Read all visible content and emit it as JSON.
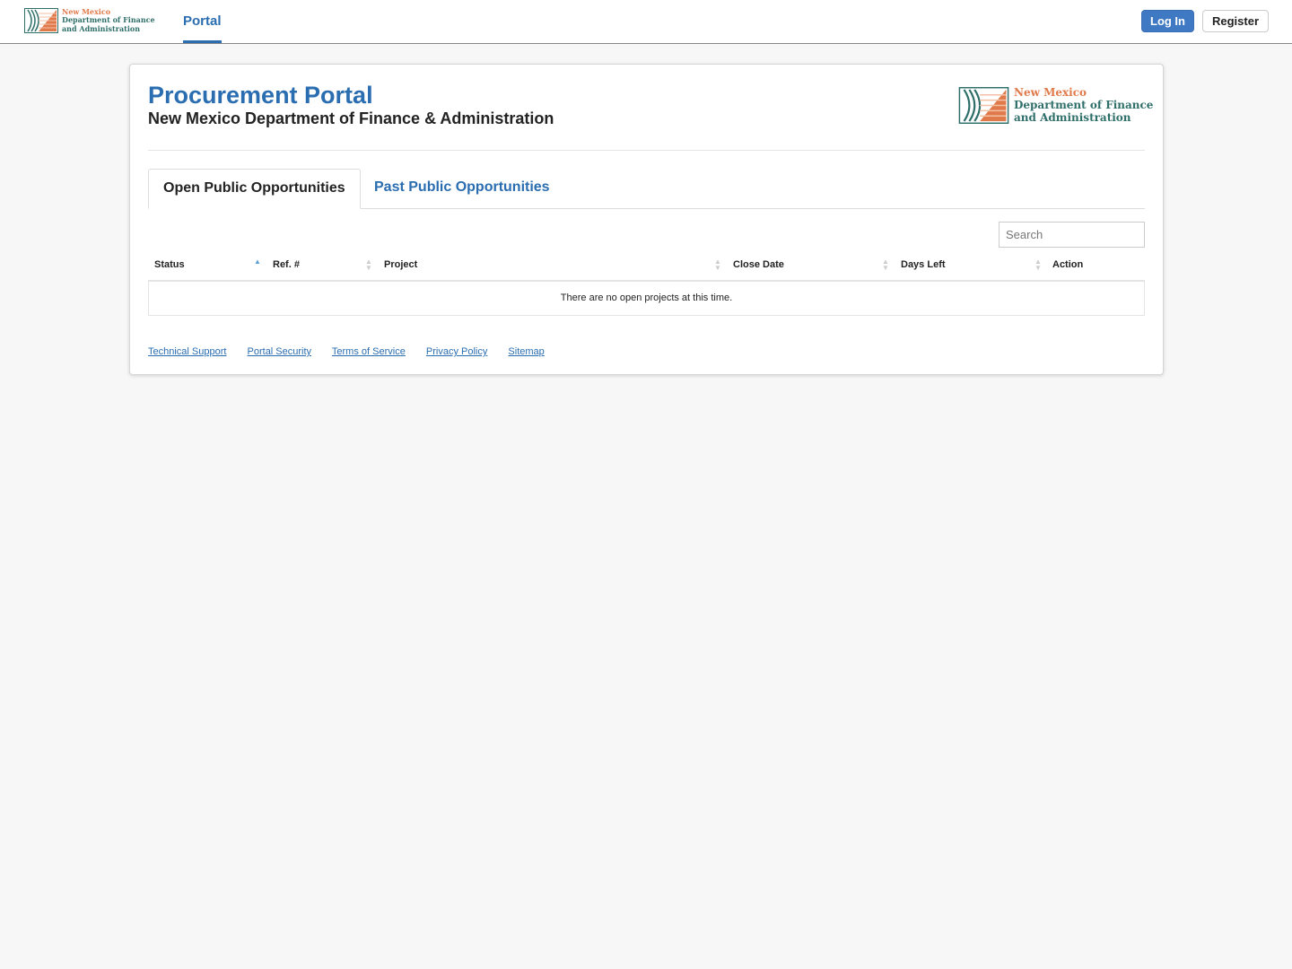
{
  "logo": {
    "line1": "New Mexico",
    "line2": "Department of Finance",
    "line3": "and Administration"
  },
  "nav": {
    "portal": "Portal",
    "login": "Log In",
    "register": "Register"
  },
  "header": {
    "title": "Procurement Portal",
    "subtitle": "New Mexico Department of Finance & Administration"
  },
  "tabs": [
    {
      "label": "Open Public Opportunities"
    },
    {
      "label": "Past Public Opportunities"
    }
  ],
  "search": {
    "placeholder": "Search",
    "value": ""
  },
  "table": {
    "columns": [
      "Status",
      "Ref. #",
      "Project",
      "Close Date",
      "Days Left",
      "Action"
    ],
    "empty": "There are no open projects at this time."
  },
  "footer": {
    "links": [
      "Technical Support",
      "Portal Security",
      "Terms of Service",
      "Privacy Policy",
      "Sitemap"
    ]
  },
  "colors": {
    "brand": "#2a6db0",
    "button": "#3f78c3",
    "logo_orange": "#e07a4b",
    "logo_teal": "#2f6f6a"
  }
}
